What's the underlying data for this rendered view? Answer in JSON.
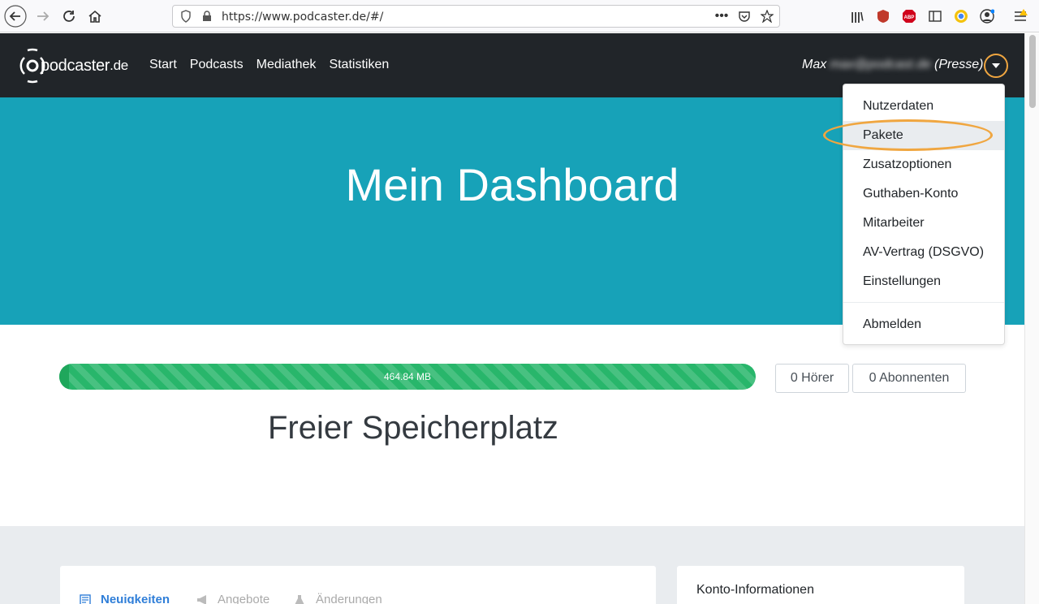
{
  "browser": {
    "url": "https://www.podcaster.de/#/"
  },
  "navbar": {
    "logo_pod": "pod",
    "logo_rest": "caster",
    "logo_tld": ".de",
    "links": [
      "Start",
      "Podcasts",
      "Mediathek",
      "Statistiken"
    ],
    "user_first": "Max",
    "user_email": "max@podcast.de",
    "user_role": "(Presse)"
  },
  "hero": {
    "title": "Mein Dashboard"
  },
  "dropdown": {
    "items": [
      "Nutzerdaten",
      "Pakete",
      "Zusatzoptionen",
      "Guthaben-Konto",
      "Mitarbeiter",
      "AV-Vertrag (DSGVO)",
      "Einstellungen"
    ],
    "logout": "Abmelden",
    "active_index": 1
  },
  "storage": {
    "used_label": "464.84 MB",
    "title": "Freier Speicherplatz",
    "fill_percent": 100,
    "listeners": "0 Hörer",
    "subscribers": "0 Abonnenten"
  },
  "tabs": {
    "news": "Neuigkeiten",
    "offers": "Angebote",
    "changes": "Änderungen"
  },
  "account": {
    "title": "Konto-Informationen"
  },
  "colors": {
    "navbar": "#212529",
    "hero": "#17a2b8",
    "progress": "#28b66b",
    "highlight": "#f0a640",
    "link_active": "#2f7ed8"
  }
}
